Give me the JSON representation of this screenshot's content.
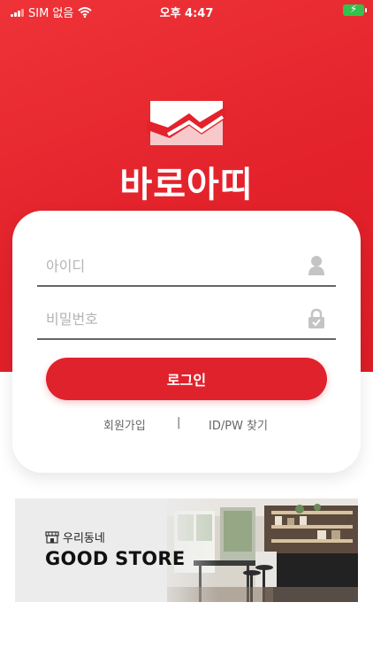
{
  "status_bar": {
    "carrier": "SIM 없음",
    "time": "오후 4:47",
    "battery_color": "#33c24d"
  },
  "brand": {
    "name": "바로아띠",
    "primary_color": "#e3222b"
  },
  "login": {
    "id_placeholder": "아이디",
    "password_placeholder": "비밀번호",
    "login_button": "로그인",
    "signup_link": "회원가입",
    "separator": "|",
    "find_link": "ID/PW 찾기"
  },
  "banner": {
    "subtitle": "우리동네",
    "title": "GOOD STORE"
  }
}
